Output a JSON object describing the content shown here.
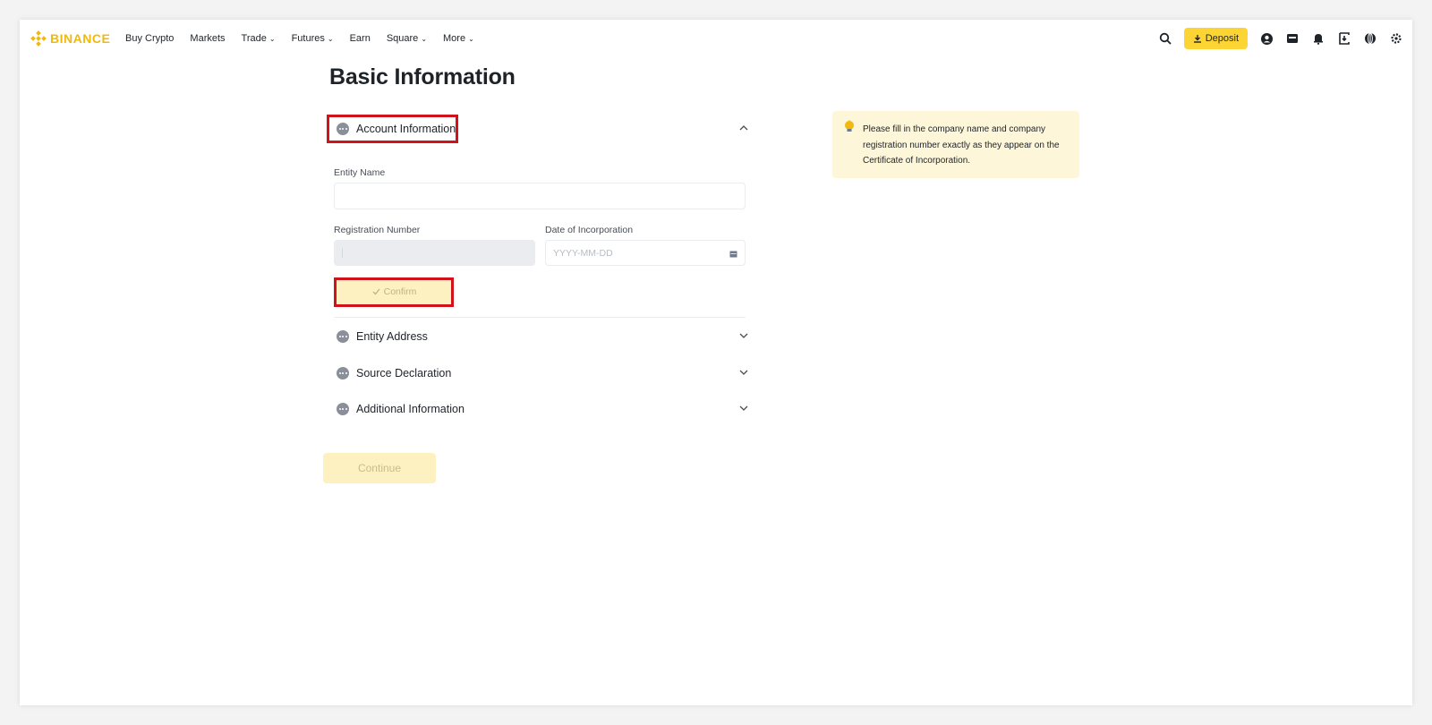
{
  "brand": {
    "name": "BINANCE",
    "color": "#f0b90b"
  },
  "nav": [
    {
      "label": "Buy Crypto",
      "has_dropdown": false
    },
    {
      "label": "Markets",
      "has_dropdown": false
    },
    {
      "label": "Trade",
      "has_dropdown": true
    },
    {
      "label": "Futures",
      "has_dropdown": true
    },
    {
      "label": "Earn",
      "has_dropdown": false
    },
    {
      "label": "Square",
      "has_dropdown": true
    },
    {
      "label": "More",
      "has_dropdown": true
    }
  ],
  "header_tools": {
    "deposit_label": "Deposit",
    "icons": [
      "search-icon",
      "deposit-icon",
      "profile-icon",
      "wallet-icon",
      "bell-icon",
      "download-icon",
      "globe-icon",
      "settings-icon"
    ]
  },
  "page": {
    "title": "Basic Information",
    "sections": {
      "account": {
        "label": "Account Information",
        "expanded": true
      },
      "address": {
        "label": "Entity Address",
        "expanded": false
      },
      "source": {
        "label": "Source Declaration",
        "expanded": false
      },
      "additional": {
        "label": "Additional Information",
        "expanded": false
      }
    },
    "form": {
      "entity_name": {
        "label": "Entity Name",
        "value": "",
        "placeholder": ""
      },
      "registration_number": {
        "label": "Registration Number",
        "value": "",
        "disabled": true
      },
      "date_of_incorporation": {
        "label": "Date of Incorporation",
        "placeholder": "YYYY-MM-DD"
      },
      "confirm_label": "Confirm"
    },
    "continue_label": "Continue",
    "tip": {
      "icon": "lightbulb-icon",
      "text": "Please fill in the company name and company registration number exactly as they appear on the Certificate of Incorporation."
    }
  },
  "colors": {
    "accent": "#fcd535",
    "highlight_border": "#d0121b",
    "tip_bg": "#fef6d8",
    "disabled_btn": "#fdf0c1"
  }
}
